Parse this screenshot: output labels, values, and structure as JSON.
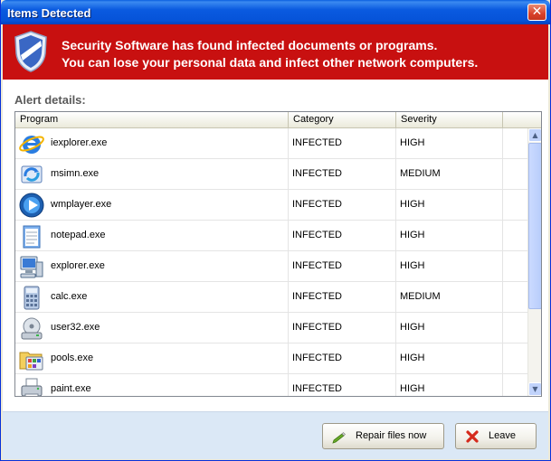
{
  "window": {
    "title": "Items Detected",
    "close_glyph": "✕"
  },
  "banner": {
    "line1": "Security Software has found infected documents or programs.",
    "line2": "You can lose your personal data and infect other network computers.",
    "icon": "shield-icon"
  },
  "alert_label": "Alert details:",
  "table": {
    "columns": [
      "Program",
      "Category",
      "Severity"
    ],
    "rows": [
      {
        "program": "iexplorer.exe",
        "category": "INFECTED",
        "severity": "HIGH",
        "icon": "internet-explorer-icon"
      },
      {
        "program": "msimn.exe",
        "category": "INFECTED",
        "severity": "MEDIUM",
        "icon": "outlook-express-icon"
      },
      {
        "program": "wmplayer.exe",
        "category": "INFECTED",
        "severity": "HIGH",
        "icon": "media-player-icon"
      },
      {
        "program": "notepad.exe",
        "category": "INFECTED",
        "severity": "HIGH",
        "icon": "notepad-icon"
      },
      {
        "program": "explorer.exe",
        "category": "INFECTED",
        "severity": "HIGH",
        "icon": "computer-icon"
      },
      {
        "program": "calc.exe",
        "category": "INFECTED",
        "severity": "MEDIUM",
        "icon": "calculator-icon"
      },
      {
        "program": "user32.exe",
        "category": "INFECTED",
        "severity": "HIGH",
        "icon": "disk-drive-icon"
      },
      {
        "program": "pools.exe",
        "category": "INFECTED",
        "severity": "HIGH",
        "icon": "control-panel-icon"
      },
      {
        "program": "paint.exe",
        "category": "INFECTED",
        "severity": "HIGH",
        "icon": "printer-icon"
      }
    ]
  },
  "scroll": {
    "up_glyph": "▲",
    "down_glyph": "▼"
  },
  "buttons": {
    "repair": "Repair files now",
    "leave": "Leave"
  },
  "colors": {
    "banner_red": "#c81010",
    "titlebar_blue": "#0653d8",
    "footer_blue": "#dbe8f6"
  }
}
